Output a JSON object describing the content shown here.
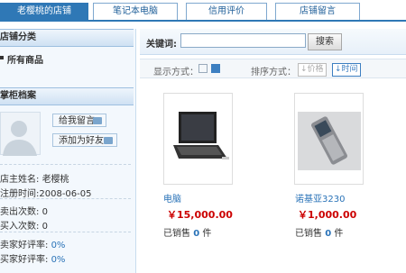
{
  "tabs": [
    {
      "label": "老樱桃的店铺",
      "active": true
    },
    {
      "label": "笔记本电脑",
      "active": false
    },
    {
      "label": "信用评价",
      "active": false
    },
    {
      "label": "店铺留言",
      "active": false
    }
  ],
  "left": {
    "category_title": "店铺分类",
    "category_all": "所有商品",
    "profile_title": "掌柜档案",
    "msg_btn": "给我留言",
    "friend_btn": "添加为好友",
    "owner_label": "店主姓名:",
    "owner_value": "老樱桃",
    "reg_label": "注册时间:",
    "reg_value": "2008-06-05",
    "sell_label": "卖出次数:",
    "sell_value": "0",
    "buy_label": "买入次数:",
    "buy_value": "0",
    "seller_rate_label": "卖家好评率:",
    "seller_rate_value": "0%",
    "buyer_rate_label": "买家好评率:",
    "buyer_rate_value": "0%"
  },
  "search": {
    "label": "关键词:",
    "value": "",
    "button": "搜索"
  },
  "view": {
    "display_label": "显示方式：",
    "sort_label": "排序方式：",
    "sort_price": "价格",
    "sort_time": "时间"
  },
  "products": [
    {
      "name": "电脑",
      "price": "￥15,000.00",
      "sold_label": "已销售",
      "sold_count": "0",
      "unit": "件"
    },
    {
      "name": "诺基亚3230",
      "price": "￥1,000.00",
      "sold_label": "已销售",
      "sold_count": "0",
      "unit": "件"
    }
  ]
}
